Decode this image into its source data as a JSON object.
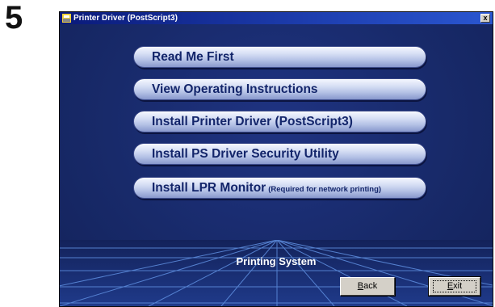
{
  "step": {
    "number": "5"
  },
  "window": {
    "title": "Printer Driver (PostScript3)",
    "close_label": "x"
  },
  "menu": {
    "items": [
      {
        "label": "Read Me First"
      },
      {
        "label": "View Operating Instructions"
      },
      {
        "label": "Install Printer Driver (PostScript3)"
      },
      {
        "label": "Install PS Driver Security Utility"
      },
      {
        "label": "Install LPR Monitor",
        "note": "(Required for network printing)"
      }
    ]
  },
  "footer": {
    "label": "Printing System",
    "back": {
      "first": "B",
      "rest": "ack"
    },
    "exit": {
      "first": "E",
      "rest": "xit"
    }
  },
  "colors": {
    "background": "#1b2b6e",
    "button_text": "#13256a",
    "grid_line": "#5f8fe0"
  }
}
